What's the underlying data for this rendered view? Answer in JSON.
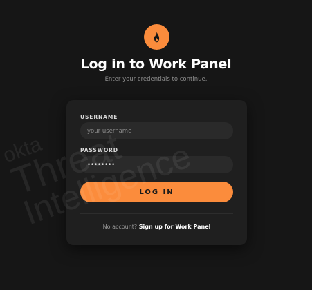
{
  "header": {
    "title": "Log in to Work Panel",
    "subtitle": "Enter your credentials to continue."
  },
  "form": {
    "username_label": "USERNAME",
    "username_placeholder": "your username",
    "username_value": "",
    "password_label": "PASSWORD",
    "password_value": "••••••••",
    "submit_label": "LOG IN",
    "footer_text": "No account? ",
    "signup_link": "Sign up for Work Panel"
  },
  "watermark": {
    "line1": "okta",
    "line2": "Threat",
    "line3": "Intelligence"
  },
  "colors": {
    "accent": "#fb8c3c",
    "background": "#161616",
    "card": "#1f1f1f",
    "input": "#2a2a2a"
  },
  "icons": {
    "logo": "flame-icon"
  }
}
